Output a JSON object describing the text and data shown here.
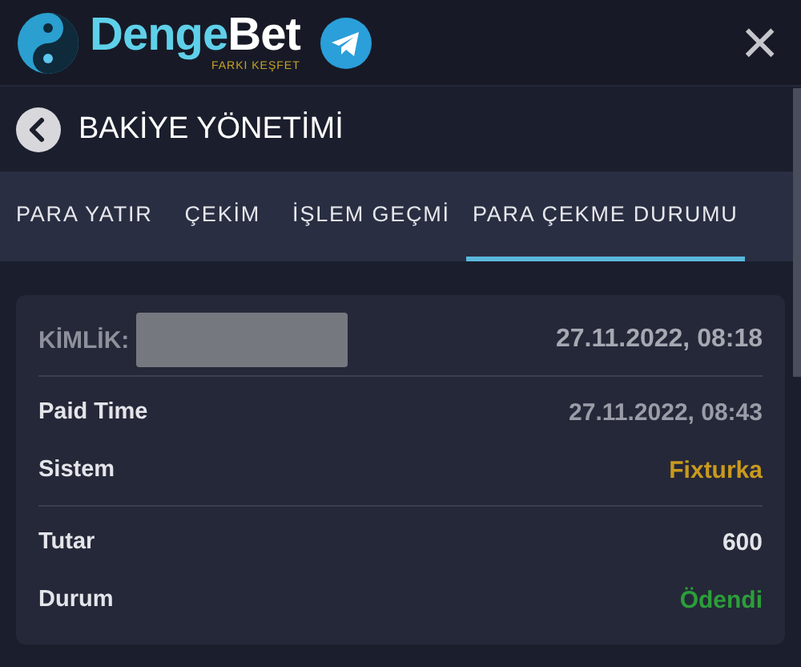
{
  "header": {
    "logo": {
      "part_1": "Denge",
      "part_2": "Bet",
      "tagline": "FARKI KEŞFET"
    },
    "close": "×"
  },
  "page_title": "BAKİYE YÖNETİMİ",
  "tabs": [
    {
      "label": "PARA YATIR",
      "selected": false
    },
    {
      "label": "ÇEKİM",
      "selected": false
    },
    {
      "label": "İŞLEM GEÇMİ",
      "selected": false
    },
    {
      "label": "PARA ÇEKME DURUMU",
      "selected": true
    }
  ],
  "card": {
    "id_label": "KİMLİK:",
    "date": "27.11.2022, 08:18",
    "groups": [
      [
        {
          "label": "Paid Time",
          "value": "27.11.2022, 08:43",
          "color": "#9a9ca8"
        },
        {
          "label": "Sistem",
          "value": "Fixturka",
          "color": "#c99a1e"
        }
      ],
      [
        {
          "label": "Tutar",
          "value": "600",
          "color": "#e4e5ea"
        },
        {
          "label": "Durum",
          "value": "Ödendi",
          "color": "#2c9e3a"
        }
      ]
    ]
  }
}
